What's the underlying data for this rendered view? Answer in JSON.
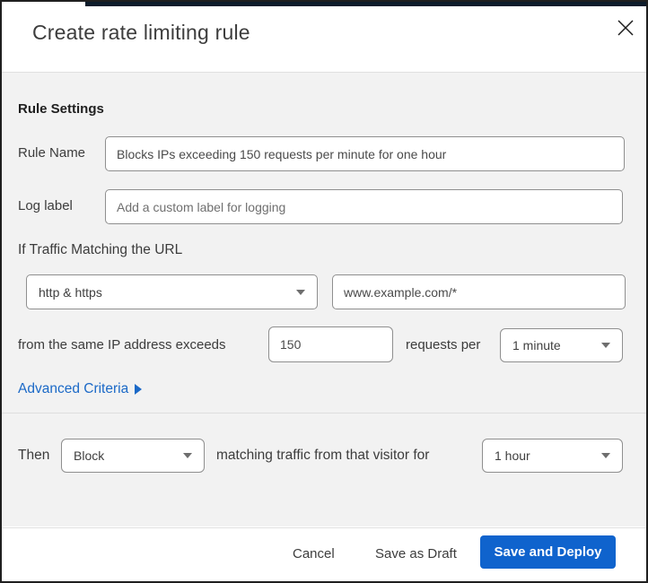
{
  "modal": {
    "title": "Create rate limiting rule",
    "section_heading": "Rule Settings",
    "fields": {
      "rule_name": {
        "label": "Rule Name",
        "value": "Blocks IPs exceeding 150 requests per minute for one hour"
      },
      "log_label": {
        "label": "Log label",
        "placeholder": "Add a custom label for logging"
      },
      "traffic_match": {
        "intro": "If Traffic Matching the URL",
        "scheme_selected": "http & https",
        "url_value": "www.example.com/*"
      },
      "threshold": {
        "prefix": "from the same IP address exceeds",
        "requests_value": "150",
        "middle": "requests per",
        "period_selected": "1 minute"
      },
      "advanced_link": "Advanced Criteria",
      "action": {
        "prefix": "Then",
        "action_selected": "Block",
        "middle": "matching traffic from that visitor for",
        "duration_selected": "1 hour"
      }
    },
    "footer": {
      "cancel_label": "Cancel",
      "save_draft_label": "Save as Draft",
      "save_deploy_label": "Save and Deploy"
    },
    "icons": {
      "close_icon": "✕",
      "chevron_down_icon": "▼",
      "expand_icon": "▶"
    },
    "colors": {
      "primary_blue": "#0f63cd",
      "link_blue": "#1b69c7",
      "body_bg": "#f2f2f2",
      "control_border": "#8f8f8f",
      "top_strip": "#0d1c2b"
    }
  }
}
